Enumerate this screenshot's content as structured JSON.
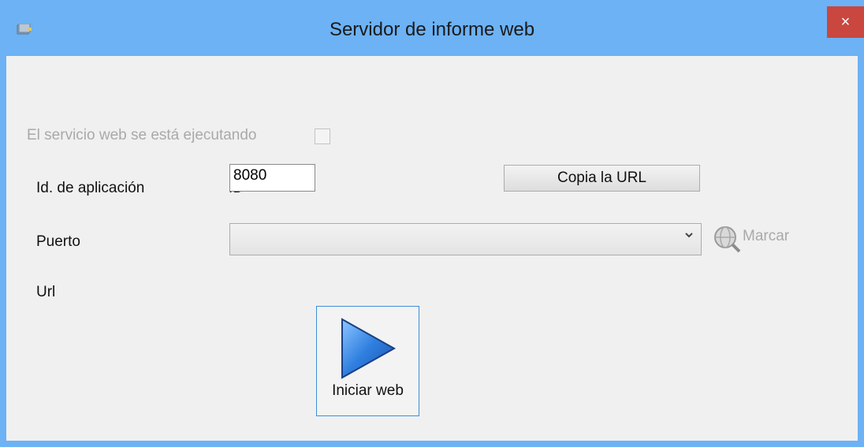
{
  "window": {
    "title": "Servidor de informe web",
    "close_glyph": "×"
  },
  "service": {
    "running_label": "El servicio web se está ejecutando",
    "running_checked": false
  },
  "app_id": {
    "label": "Id. de aplicación",
    "value": "ID"
  },
  "port": {
    "label": "Puerto",
    "value": "8080"
  },
  "copy_url_button": "Copia la URL",
  "url": {
    "label": "Url",
    "selected": ""
  },
  "marcar_button": "Marcar",
  "start_button": "Iniciar web",
  "colors": {
    "title_bar": "#6cb2f5",
    "close_button": "#c9473f",
    "client_bg": "#f0f0f0",
    "start_button_border": "#3c8fd8"
  },
  "icons": {
    "app": "report-icon",
    "close": "close-icon",
    "dropdown": "chevron-down-icon",
    "marcar": "globe-search-icon",
    "start": "play-icon"
  }
}
